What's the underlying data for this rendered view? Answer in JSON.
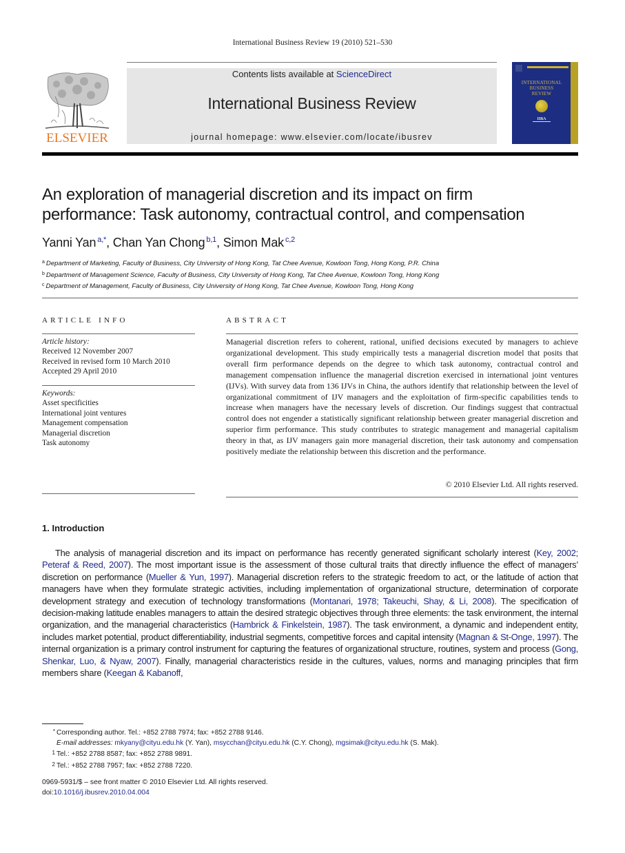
{
  "running_header": "International Business Review 19 (2010) 521–530",
  "masthead": {
    "contents_prefix": "Contents lists available at ",
    "contents_link": "ScienceDirect",
    "journal_title": "International Business Review",
    "homepage": "journal homepage: www.elsevier.com/locate/ibusrev",
    "publisher_logo_text": "ELSEVIER",
    "cover": {
      "title_lines": [
        "INTERNATIONAL",
        "BUSINESS",
        "REVIEW"
      ],
      "badge": "IIBA",
      "colors": {
        "background": "#1d2d82",
        "stripe": "#b9a223"
      }
    }
  },
  "article": {
    "title_line1": "An exploration of managerial discretion and its impact on firm",
    "title_line2": "performance: Task autonomy, contractual control, and compensation",
    "authors": [
      {
        "name": "Yanni Yan",
        "marks": "a,*"
      },
      {
        "name": "Chan Yan Chong",
        "marks": "b,1"
      },
      {
        "name": "Simon Mak",
        "marks": "c,2"
      }
    ],
    "affiliations": [
      {
        "mark": "a",
        "text": "Department of Marketing, Faculty of Business, City University of Hong Kong, Tat Chee Avenue, Kowloon Tong, Hong Kong, P.R. China"
      },
      {
        "mark": "b",
        "text": "Department of Management Science, Faculty of Business, City University of Hong Kong, Tat Chee Avenue, Kowloon Tong, Hong Kong"
      },
      {
        "mark": "c",
        "text": "Department of Management, Faculty of Business, City University of Hong Kong, Tat Chee Avenue, Kowloon Tong, Hong Kong"
      }
    ]
  },
  "article_info": {
    "heading": "ARTICLE INFO",
    "history_label": "Article history:",
    "history": [
      "Received 12 November 2007",
      "Received in revised form 10 March 2010",
      "Accepted 29 April 2010"
    ],
    "keywords_label": "Keywords:",
    "keywords": [
      "Asset specificities",
      "International joint ventures",
      "Management compensation",
      "Managerial discretion",
      "Task autonomy"
    ]
  },
  "abstract": {
    "heading": "ABSTRACT",
    "text": "Managerial discretion refers to coherent, rational, unified decisions executed by managers to achieve organizational development. This study empirically tests a managerial discretion model that posits that overall firm performance depends on the degree to which task autonomy, contractual control and management compensation influence the managerial discretion exercised in international joint ventures (IJVs). With survey data from 136 IJVs in China, the authors identify that relationship between the level of organizational commitment of IJV managers and the exploitation of firm-specific capabilities tends to increase when managers have the necessary levels of discretion. Our findings suggest that contractual control does not engender a statistically significant relationship between greater managerial discretion and superior firm performance. This study contributes to strategic management and managerial capitalism theory in that, as IJV managers gain more managerial discretion, their task autonomy and compensation positively mediate the relationship between this discretion and the performance.",
    "copyright": "© 2010 Elsevier Ltd. All rights reserved."
  },
  "introduction": {
    "heading": "1.  Introduction",
    "segments": [
      {
        "t": "The analysis of managerial discretion and its impact on performance has recently generated significant scholarly interest ("
      },
      {
        "t": "Key, 2002; Peteraf & Reed, 2007",
        "link": true
      },
      {
        "t": "). The most important issue is the assessment of those cultural traits that directly influence the effect of managers’ discretion on performance ("
      },
      {
        "t": "Mueller & Yun, 1997",
        "link": true
      },
      {
        "t": "). Managerial discretion refers to the strategic freedom to act, or the latitude of action that managers have when they formulate strategic activities, including implementation of organizational structure, determination of corporate development strategy and execution of technology transformations ("
      },
      {
        "t": "Montanari, 1978; Takeuchi, Shay, & Li, 2008",
        "link": true
      },
      {
        "t": "). The specification of decision-making latitude enables managers to attain the desired strategic objectives through three elements: the task environment, the internal organization, and the managerial characteristics ("
      },
      {
        "t": "Hambrick & Finkelstein, 1987",
        "link": true
      },
      {
        "t": "). The task environment, a dynamic and independent entity, includes market potential, product differentiability, industrial segments, competitive forces and capital intensity ("
      },
      {
        "t": "Magnan & St-Onge, 1997",
        "link": true
      },
      {
        "t": "). The internal organization is a primary control instrument for capturing the features of organizational structure, routines, system and process ("
      },
      {
        "t": "Gong, Shenkar, Luo, & Nyaw, 2007",
        "link": true
      },
      {
        "t": "). Finally, managerial characteristics reside in the cultures, values, norms and managing principles that firm members share ("
      },
      {
        "t": "Keegan & Kabanoff,",
        "link": true
      }
    ]
  },
  "footnotes": {
    "corresponding": {
      "mark": "*",
      "text": "Corresponding author. Tel.: +852 2788 7974; fax: +852 2788 9146."
    },
    "emails_label": "E-mail addresses:",
    "emails": [
      {
        "email": "mkyany@cityu.edu.hk",
        "who": "(Y. Yan)"
      },
      {
        "email": "msycchan@cityu.edu.hk",
        "who": "(C.Y. Chong)"
      },
      {
        "email": "mgsimak@cityu.edu.hk",
        "who": "(S. Mak)."
      }
    ],
    "notes": [
      {
        "mark": "1",
        "text": "Tel.: +852 2788 8587; fax: +852 2788 9891."
      },
      {
        "mark": "2",
        "text": "Tel.: +852 2788 7957; fax: +852 2788 7220."
      }
    ]
  },
  "front_matter": {
    "line1": "0969-5931/$ – see front matter © 2010 Elsevier Ltd. All rights reserved.",
    "doi_prefix": "doi:",
    "doi": "10.1016/j.ibusrev.2010.04.004"
  },
  "colors": {
    "link": "#1f2a8c",
    "elsevier_orange": "#e87722",
    "masthead_bg": "#e6e6e6"
  }
}
